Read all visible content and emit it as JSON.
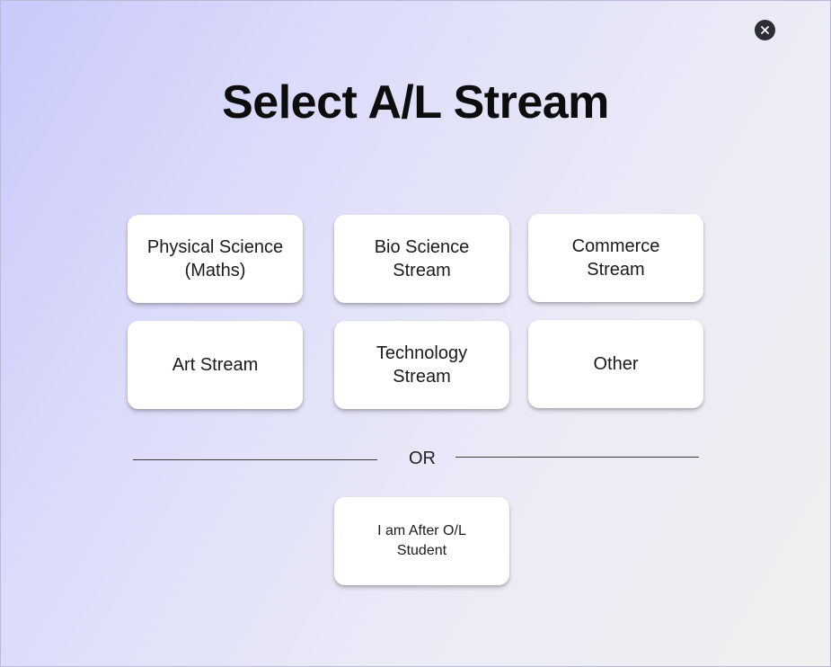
{
  "dialog": {
    "title": "Select A/L Stream",
    "close_icon": "close-icon",
    "streams": [
      {
        "label": "Physical Science\n(Maths)"
      },
      {
        "label": "Bio Science\nStream"
      },
      {
        "label": "Commerce\nStream"
      },
      {
        "label": "Art Stream"
      },
      {
        "label": "Technology\nStream"
      },
      {
        "label": "Other"
      }
    ],
    "separator_text": "OR",
    "after_ol_label": "I am After O/L\nStudent"
  },
  "colors": {
    "background_start": "#c9c9fb",
    "background_end": "#f0efef",
    "card": "#ffffff",
    "close_button": "#2a2c36"
  }
}
